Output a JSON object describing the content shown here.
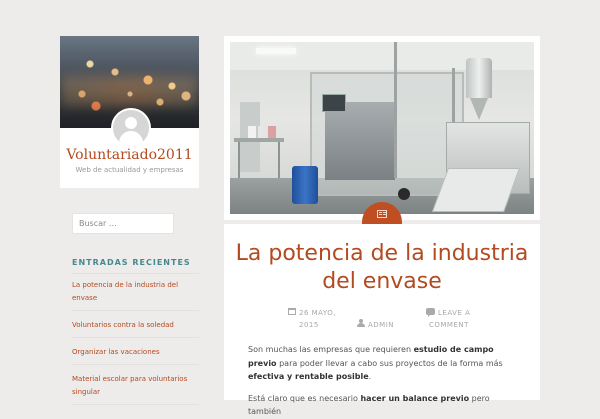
{
  "site": {
    "title": "Voluntariado2011",
    "description": "Web de actualidad y empresas"
  },
  "search": {
    "placeholder": "Buscar …"
  },
  "recent_posts": {
    "heading": "ENTRADAS RECIENTES",
    "items": [
      "La potencia de la industria del envase",
      "Voluntarios contra la soledad",
      "Organizar las vacaciones",
      "Material escolar para voluntarios singular"
    ]
  },
  "post": {
    "title": "La potencia de la industria del envase",
    "date_line1": "26 MAYO,",
    "date_line2": "2015",
    "author": "ADMIN",
    "comments_line1": "LEAVE A",
    "comments_line2": "COMMENT",
    "excerpt_p1": {
      "t1": "Son muchas las empresas que requieren ",
      "b1": "estudio de campo previo",
      "t2": " para poder llevar a cabo sus proyectos de la forma más ",
      "b2": "efectiva y rentable posible",
      "t3": "."
    },
    "excerpt_p2": {
      "t1": "Está claro que es necesario ",
      "b1": "hacer un balance previo",
      "t2": " pero también"
    }
  },
  "icons": {
    "featured": "production-machine-photo",
    "format": "image-format-icon",
    "date": "calendar-icon",
    "author": "user-icon",
    "comments": "comment-icon"
  },
  "colors": {
    "accent": "#b34a20",
    "widget_heading": "#47888f",
    "background": "#edecea"
  }
}
